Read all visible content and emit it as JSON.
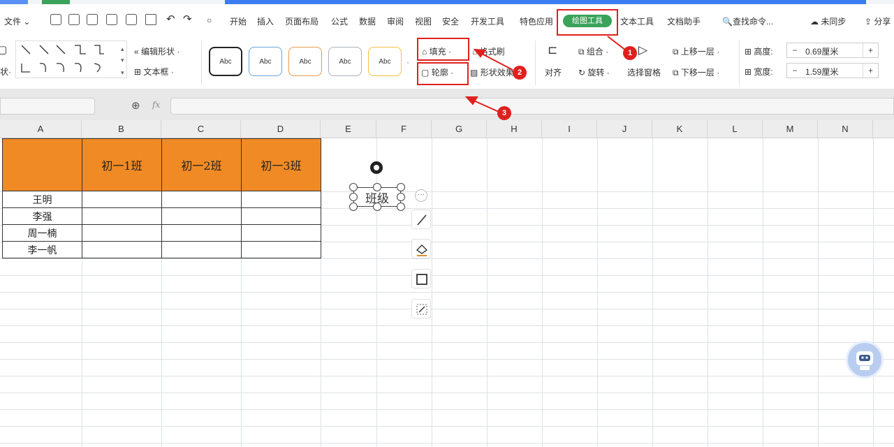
{
  "menubar": {
    "file_menu": "文件",
    "tabs": [
      "开始",
      "插入",
      "页面布局",
      "公式",
      "数据",
      "审阅",
      "视图",
      "安全",
      "开发工具",
      "特色应用",
      "绘图工具",
      "文本工具",
      "文档助手"
    ],
    "search": "查找命令...",
    "sync": "未同步",
    "share": "分享"
  },
  "ribbon": {
    "edit_shape": "编辑形状",
    "text_box": "文本框",
    "style_samples": [
      "Abc",
      "Abc",
      "Abc",
      "Abc",
      "Abc"
    ],
    "fill": "填充",
    "format_painter": "格式刷",
    "outline": "轮廓",
    "shape_effects": "形状效果",
    "align": "对齐",
    "group": "组合",
    "rotate": "旋转",
    "selection_pane": "选择窗格",
    "bring_forward": "上移一层",
    "send_backward": "下移一层",
    "height_label": "高度:",
    "height_value": "0.69厘米",
    "width_label": "宽度:",
    "width_value": "1.59厘米",
    "minus": "−",
    "plus": "+"
  },
  "formula_bar": {
    "fx": "fx"
  },
  "columns": [
    "A",
    "B",
    "C",
    "D",
    "E",
    "F",
    "G",
    "H",
    "I",
    "J",
    "K",
    "L",
    "M",
    "N"
  ],
  "table": {
    "headers": [
      "",
      "初一1班",
      "初一2班",
      "初一3班"
    ],
    "names": [
      "王明",
      "李强",
      "周一楠",
      "李一帆"
    ]
  },
  "shape": {
    "text": "班级"
  },
  "annotations": {
    "m1": "1",
    "m2": "2",
    "m3": "3"
  },
  "colors": {
    "accent_blue": "#3d7bf0",
    "header_orange": "#f08a24",
    "annotation_red": "#e0201e",
    "active_tab_green": "#3aa35a"
  }
}
